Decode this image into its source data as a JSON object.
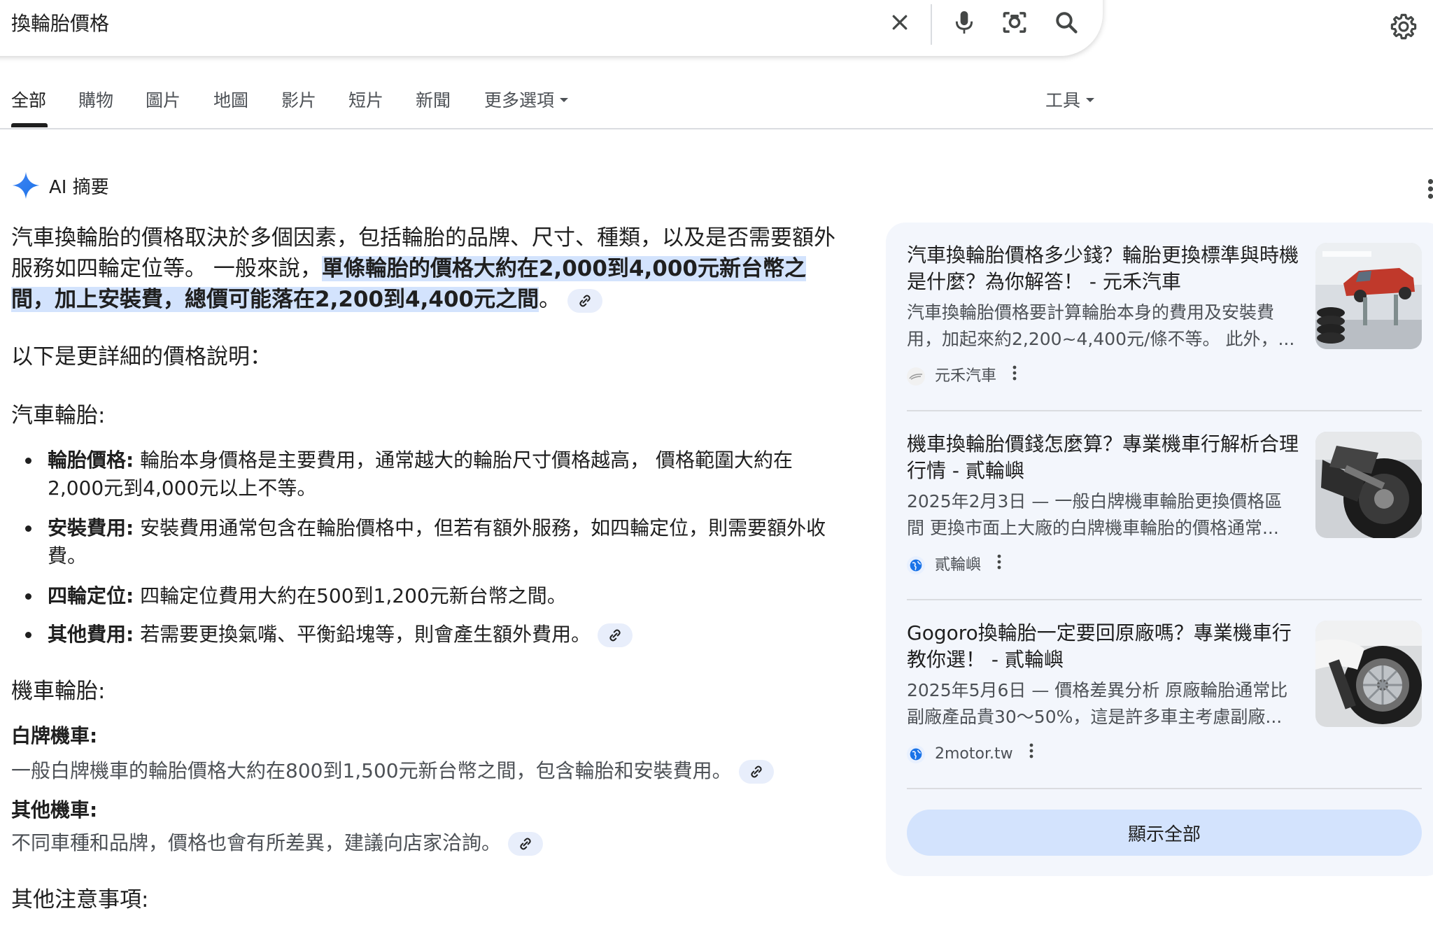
{
  "search": {
    "query": "換輪胎價格",
    "icons": [
      "close-icon",
      "microphone-icon",
      "lens-camera-icon",
      "search-icon",
      "settings-gear-icon"
    ]
  },
  "tabs": {
    "items": [
      "全部",
      "購物",
      "圖片",
      "地圖",
      "影片",
      "短片",
      "新聞",
      "更多選項"
    ],
    "active": "全部",
    "tools": "工具"
  },
  "ai_overview": {
    "title": "AI 摘要",
    "intro_plain": "汽車換輪胎的價格取決於多個因素，包括輪胎的品牌、尺寸、種類，以及是否需要額外服務如四輪定位等。 一般來說，",
    "intro_highlight": "單條輪胎的價格大約在2,000到4,000元新台幣之間，加上安裝費，總價可能落在2,200到4,400元之間",
    "intro_end": "。",
    "details_heading": "以下是更詳細的價格說明：",
    "car_heading": "汽車輪胎:",
    "car_items": [
      {
        "label": "輪胎價格:",
        "text": " 輪胎本身價格是主要費用，通常越大的輪胎尺寸價格越高， 價格範圍大約在2,000元到4,000元以上不等。"
      },
      {
        "label": "安裝費用:",
        "text": " 安裝費用通常包含在輪胎價格中，但若有額外服務，如四輪定位，則需要額外收費。"
      },
      {
        "label": "四輪定位:",
        "text": " 四輪定位費用大約在500到1,200元新台幣之間。"
      },
      {
        "label": "其他費用:",
        "text": " 若需要更換氣嘴、平衡鉛塊等，則會產生額外費用。"
      }
    ],
    "moto_heading": "機車輪胎:",
    "white_plate_heading": "白牌機車:",
    "white_plate_text": "一般白牌機車的輪胎價格大約在800到1,500元新台幣之間，包含輪胎和安裝費用。",
    "other_moto_heading": "其他機車:",
    "other_moto_text": "不同車種和品牌，價格也會有所差異，建議向店家洽詢。",
    "notes_heading": "其他注意事項:"
  },
  "sources": {
    "cards": [
      {
        "title": "汽車換輪胎價格多少錢？輪胎更換標準與時機是什麼？為你解答！ - 元禾汽車",
        "snippet": "汽車換輪胎價格要計算輪胎本身的費用及安裝費用，加起來約2,200~4,400元/條不等。 此外，...",
        "source": "元禾汽車",
        "thumb": "car-on-lift"
      },
      {
        "title": "機車換輪胎價錢怎麼算？專業機車行解析合理行情 - 貳輪嶼",
        "snippet": "2025年2月3日 — 一般白牌機車輪胎更換價格區間 更換市面上大廠的白牌機車輪胎的價格通常...",
        "source": "貳輪嶼",
        "thumb": "motorcycle-wheel"
      },
      {
        "title": "Gogoro換輪胎一定要回原廠嗎？專業機車行教你選！ - 貳輪嶼",
        "snippet": "2025年5月6日 — 價格差異分析 原廠輪胎通常比副廠產品貴30～50%，這是許多車主考慮副廠...",
        "source": "2motor.tw",
        "thumb": "scooter-wheel"
      }
    ],
    "show_all": "顯示全部"
  },
  "colors": {
    "highlight": "#d3e3fd",
    "panel_bg": "#f3f6fc",
    "accent_blue": "#1a73e8"
  }
}
